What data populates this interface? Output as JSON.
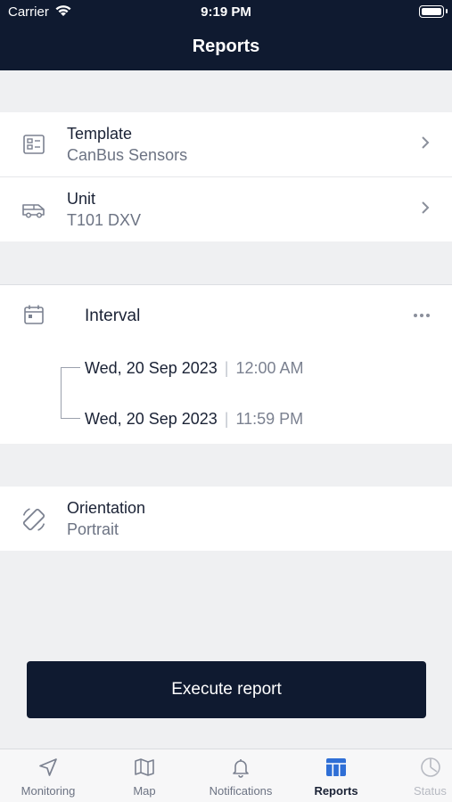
{
  "status_bar": {
    "carrier": "Carrier",
    "time": "9:19 PM"
  },
  "header": {
    "title": "Reports"
  },
  "template": {
    "label": "Template",
    "value": "CanBus Sensors",
    "icon": "template-icon"
  },
  "unit": {
    "label": "Unit",
    "value": "T101 DXV",
    "icon": "truck-icon"
  },
  "interval": {
    "label": "Interval",
    "icon": "calendar-icon",
    "from": {
      "date": "Wed, 20 Sep 2023",
      "time": "12:00 AM"
    },
    "to": {
      "date": "Wed, 20 Sep 2023",
      "time": "11:59 PM"
    }
  },
  "orientation": {
    "label": "Orientation",
    "value": "Portrait",
    "icon": "rotate-icon"
  },
  "execute": {
    "label": "Execute report"
  },
  "tabs": [
    {
      "label": "Monitoring",
      "icon": "navigation-arrow-icon"
    },
    {
      "label": "Map",
      "icon": "map-icon"
    },
    {
      "label": "Notifications",
      "icon": "bell-icon"
    },
    {
      "label": "Reports",
      "icon": "table-icon",
      "active": true
    },
    {
      "label": "Status",
      "icon": "pie-chart-icon"
    }
  ],
  "colors": {
    "header_bg": "#0f1a30",
    "accent": "#2f6fd6",
    "background": "#eff0f2"
  }
}
